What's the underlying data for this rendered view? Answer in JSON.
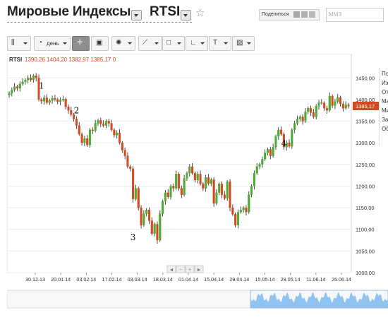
{
  "header": {
    "title": "Мировые Индексы",
    "instrument": "RTSI",
    "share_label": "Поделиться",
    "search_placeholder": "ММЗ"
  },
  "toolbar": {
    "period_label": "день",
    "tools": [
      "candles-icon",
      "clock-icon",
      "crosshair-icon",
      "save-icon",
      "indicators-icon",
      "line-draw-icon",
      "shapes-icon",
      "axis-icon",
      "text-icon",
      "image-icon"
    ]
  },
  "legend": {
    "name": "RTSI",
    "ohlc": "1390,26  1404,20  1382,97  1385,17  0"
  },
  "side_panel": [
    "По",
    "Из",
    "От",
    "Ма",
    "Ми",
    "За",
    "Об"
  ],
  "nav": [
    "◄",
    "−",
    "+",
    "►"
  ],
  "colors": {
    "up": "#4caa35",
    "down": "#d44a20",
    "price_tag": "#d44a20",
    "nav_fill": "#8ec3f2"
  },
  "chart_data": {
    "type": "candlestick",
    "instrument": "RTSI",
    "y_ticks": [
      "1450,00",
      "1400,00",
      "1350,00",
      "1300,00",
      "1250,00",
      "1200,00",
      "1150,00",
      "1100,00",
      "1050,00",
      "1000,00"
    ],
    "ylim": [
      1000,
      1470
    ],
    "x_ticks": [
      "30.12.13",
      "20.01.14",
      "03.02.14",
      "17.02.14",
      "03.03.14",
      "18.03.14",
      "01.04.14",
      "15.04.14",
      "29.04.14",
      "15.05.14",
      "29.05.14",
      "11.06.14",
      "26.06.14"
    ],
    "last_price": "1385,17",
    "annotations": [
      {
        "text": "1",
        "x_index": 11,
        "y": 1425
      },
      {
        "text": "2",
        "x_index": 24,
        "y": 1368
      },
      {
        "text": "3",
        "x_index": 45,
        "y": 1075
      },
      {
        "text": "4",
        "x_index": 101,
        "y": 1292
      }
    ],
    "closes": [
      1415,
      1422,
      1430,
      1426,
      1436,
      1441,
      1445,
      1450,
      1445,
      1455,
      1450,
      1400,
      1396,
      1404,
      1393,
      1398,
      1403,
      1400,
      1395,
      1399,
      1401,
      1383,
      1375,
      1365,
      1355,
      1340,
      1320,
      1300,
      1310,
      1295,
      1330,
      1328,
      1345,
      1352,
      1344,
      1340,
      1350,
      1345,
      1330,
      1318,
      1323,
      1300,
      1283,
      1270,
      1245,
      1240,
      1170,
      1195,
      1150,
      1110,
      1136,
      1145,
      1120,
      1090,
      1112,
      1075,
      1136,
      1165,
      1185,
      1175,
      1200,
      1195,
      1228,
      1195,
      1180,
      1218,
      1230,
      1245,
      1230,
      1214,
      1228,
      1205,
      1195,
      1220,
      1206,
      1215,
      1160,
      1185,
      1205,
      1180,
      1172,
      1210,
      1150,
      1135,
      1110,
      1140,
      1145,
      1150,
      1140,
      1180,
      1200,
      1230,
      1245,
      1250,
      1262,
      1277,
      1285,
      1270,
      1290,
      1315,
      1330,
      1320,
      1290,
      1300,
      1292,
      1330,
      1345,
      1355,
      1360,
      1350,
      1372,
      1380,
      1370,
      1360,
      1385,
      1393,
      1392,
      1380,
      1375,
      1408,
      1386,
      1395,
      1405,
      1390,
      1380,
      1388,
      1385
    ]
  }
}
